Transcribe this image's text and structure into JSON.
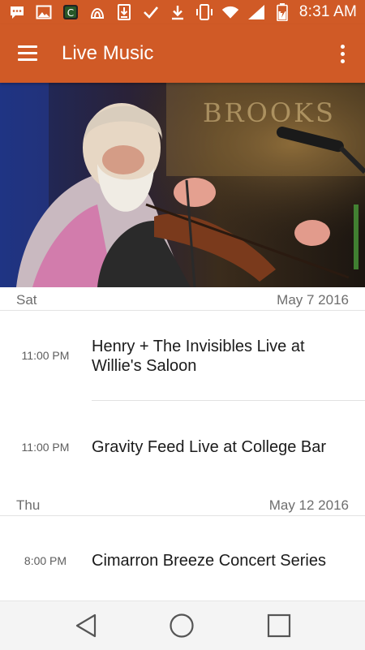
{
  "status_bar": {
    "time": "8:31 AM",
    "left_icons": [
      "message-icon",
      "gallery-icon",
      "app-icon",
      "android-icon",
      "download-box-icon",
      "check-icon",
      "download-icon"
    ],
    "right_icons": [
      "vibrate-icon",
      "wifi-icon",
      "signal-icon",
      "battery-charging-icon"
    ]
  },
  "app_bar": {
    "title": "Live Music",
    "menu_icon": "hamburger-menu-icon",
    "overflow_icon": "more-vert-icon",
    "color": "#d05a26"
  },
  "hero": {
    "description_icon": "fiddle-player-photo"
  },
  "sections": [
    {
      "day": "Sat",
      "date": "May 7 2016",
      "events": [
        {
          "time": "11:00 PM",
          "title": "Henry + The Invisibles Live at Willie's Saloon"
        },
        {
          "time": "11:00 PM",
          "title": "Gravity Feed Live at College Bar"
        }
      ]
    },
    {
      "day": "Thu",
      "date": "May 12 2016",
      "events": [
        {
          "time": "8:00 PM",
          "title": "Cimarron Breeze Concert Series"
        }
      ]
    }
  ],
  "nav_bar": {
    "icons": [
      "back-icon",
      "home-icon",
      "recents-icon"
    ]
  }
}
